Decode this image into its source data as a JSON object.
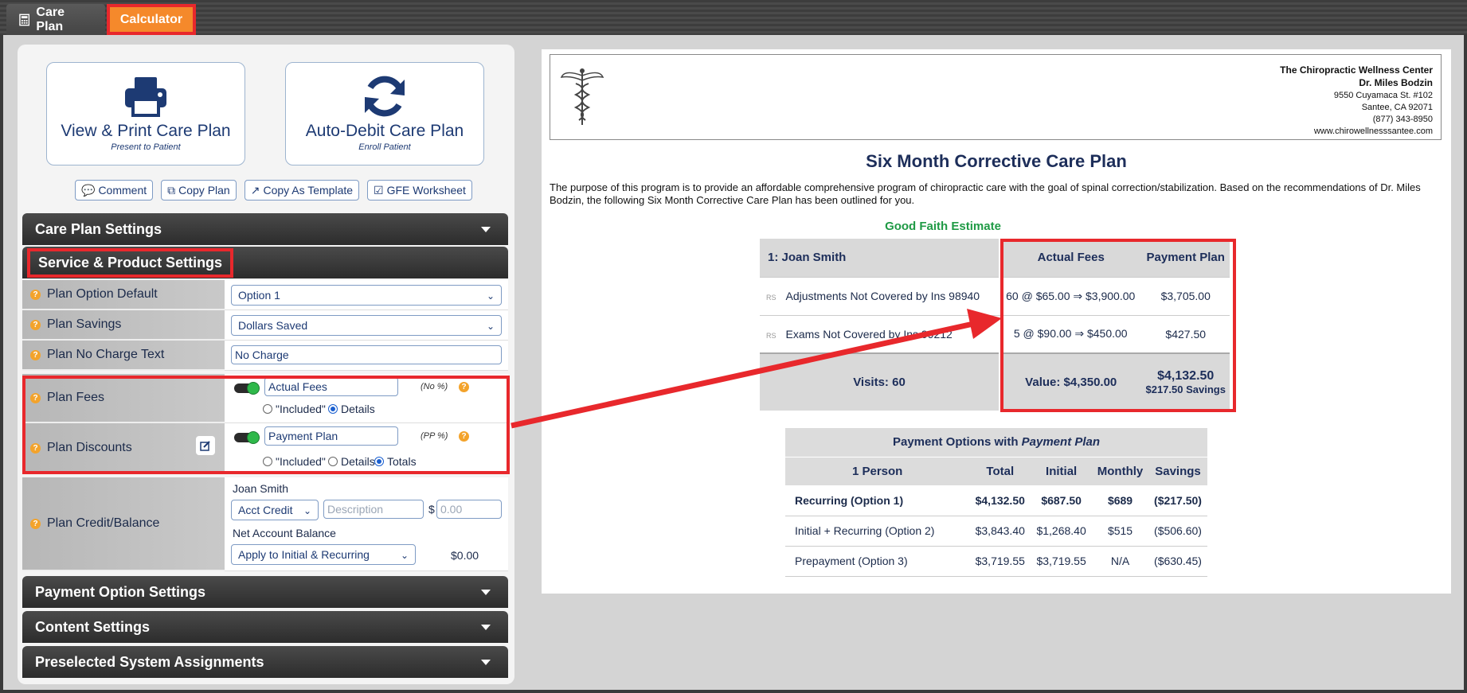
{
  "tabs": {
    "care_plan": "Care Plan",
    "calculator": "Calculator"
  },
  "actions": {
    "view_print": {
      "title": "View & Print Care Plan",
      "subtitle": "Present to Patient"
    },
    "auto_debit": {
      "title": "Auto-Debit Care Plan",
      "subtitle": "Enroll Patient"
    },
    "comment": "Comment",
    "copy_plan": "Copy Plan",
    "copy_template": "Copy As Template",
    "gfe_worksheet": "GFE Worksheet"
  },
  "sections": {
    "care_plan_settings": "Care Plan Settings",
    "service_product": "Service & Product Settings",
    "payment_option": "Payment Option Settings",
    "content": "Content Settings",
    "preselected": "Preselected System Assignments"
  },
  "settings": {
    "plan_option_default": {
      "label": "Plan Option Default",
      "value": "Option 1"
    },
    "plan_savings": {
      "label": "Plan Savings",
      "value": "Dollars Saved"
    },
    "plan_no_charge": {
      "label": "Plan No Charge Text",
      "value": "No Charge"
    },
    "plan_fees": {
      "label": "Plan Fees",
      "value": "Actual Fees",
      "pct": "(No %)",
      "opt1": "\"Included\"",
      "opt2": "Details"
    },
    "plan_discounts": {
      "label": "Plan Discounts",
      "value": "Payment Plan",
      "pct": "(PP %)",
      "opt1": "\"Included\"",
      "opt2": "Details",
      "opt3": "Totals"
    },
    "plan_credit": {
      "label": "Plan Credit/Balance",
      "patient": "Joan Smith",
      "credit_type": "Acct Credit",
      "desc_placeholder": "Description",
      "currency": "$",
      "amount_placeholder": "0.00",
      "net_label": "Net Account Balance",
      "apply": "Apply to Initial & Recurring",
      "net_value": "$0.00"
    }
  },
  "doc": {
    "clinic": {
      "name": "The Chiropractic Wellness Center",
      "doctor": "Dr. Miles Bodzin",
      "address": "9550 Cuyamaca St. #102",
      "city": "Santee, CA 92071",
      "phone": "(877) 343-8950",
      "web": "www.chirowellnesssantee.com"
    },
    "title": "Six Month Corrective Care Plan",
    "intro": "The purpose of this program is to provide an affordable comprehensive program of chiropractic care with the goal of spinal correction/stabilization. Based on the recommendations of Dr. Miles Bodzin, the following Six Month Corrective Care Plan has been outlined for you.",
    "gfe_heading": "Good Faith Estimate",
    "gfe": {
      "patient": "1: Joan Smith",
      "col_actual": "Actual Fees",
      "col_plan": "Payment Plan",
      "rows": [
        {
          "tag": "RS",
          "service": "Adjustments Not Covered by Ins 98940",
          "actual": "60 @ $65.00 ⇒ $3,900.00",
          "plan": "$3,705.00"
        },
        {
          "tag": "RS",
          "service": "Exams Not Covered by Ins 99212",
          "actual": "5 @ $90.00 ⇒ $450.00",
          "plan": "$427.50"
        }
      ],
      "visits": "Visits: 60",
      "value": "Value: $4,350.00",
      "plan_total": "$4,132.50",
      "plan_savings": "$217.50 Savings"
    },
    "payment_options": {
      "title_prefix": "Payment Options with ",
      "title_em": "Payment Plan",
      "headers": [
        "1 Person",
        "Total",
        "Initial",
        "Monthly",
        "Savings"
      ],
      "rows": [
        [
          "Recurring (Option 1)",
          "$4,132.50",
          "$687.50",
          "$689",
          "($217.50)"
        ],
        [
          "Initial + Recurring (Option 2)",
          "$3,843.40",
          "$1,268.40",
          "$515",
          "($506.60)"
        ],
        [
          "Prepayment (Option 3)",
          "$3,719.55",
          "$3,719.55",
          "N/A",
          "($630.45)"
        ]
      ]
    }
  },
  "colors": {
    "accent_orange": "#f5892b",
    "highlight_red": "#e8282c",
    "gfe_green": "#1f9a45",
    "navy": "#1d3a73"
  }
}
